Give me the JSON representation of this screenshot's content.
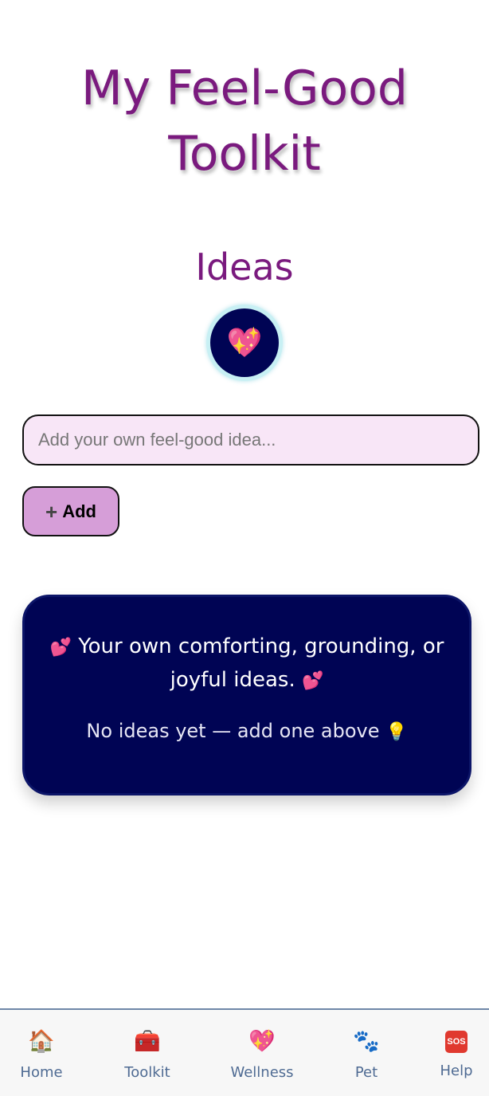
{
  "header": {
    "title_line1": "My Feel-Good",
    "title_line2": "Toolkit"
  },
  "section": {
    "title": "Ideas",
    "icon": "sparkling-heart-icon",
    "emoji": "💖"
  },
  "form": {
    "input_value": "",
    "input_placeholder": "Add your own feel-good idea...",
    "add_plus": "+",
    "add_label": "Add"
  },
  "card": {
    "desc_emoji_left": "💕",
    "desc_text": "Your own comforting, grounding, or joyful ideas.",
    "desc_emoji_right": "💕",
    "empty_text": "No ideas yet — add one above",
    "empty_emoji": "💡"
  },
  "nav": {
    "items": [
      {
        "label": "Home",
        "icon": "house-icon",
        "emoji": "🏠"
      },
      {
        "label": "Toolkit",
        "icon": "toolbox-icon",
        "emoji": "🧰"
      },
      {
        "label": "Wellness",
        "icon": "sparkling-heart-icon",
        "emoji": "💖"
      },
      {
        "label": "Pet",
        "icon": "paw-prints-icon",
        "emoji": "🐾"
      },
      {
        "label": "Help",
        "icon": "sos-icon",
        "emoji": "SOS"
      }
    ]
  },
  "colors": {
    "title": "#7a1a7e",
    "card_bg": "#000454",
    "input_bg": "#f8e6f7",
    "button_bg": "#d69ed8",
    "nav_label": "#4f6b93",
    "nav_border": "#6f87a8"
  }
}
